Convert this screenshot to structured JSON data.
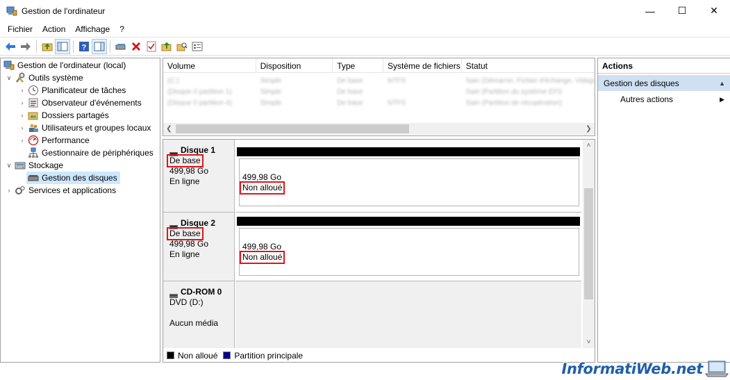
{
  "window": {
    "title": "Gestion de l'ordinateur"
  },
  "menu": [
    "Fichier",
    "Action",
    "Affichage",
    "?"
  ],
  "tree": [
    {
      "label": "Gestion de l'ordinateur (local)",
      "icon": "computer-management-icon"
    },
    {
      "label": "Outils système",
      "icon": "system-tools-icon"
    },
    {
      "label": "Planificateur de tâches",
      "icon": "task-scheduler-icon"
    },
    {
      "label": "Observateur d'événements",
      "icon": "event-viewer-icon"
    },
    {
      "label": "Dossiers partagés",
      "icon": "shared-folders-icon"
    },
    {
      "label": "Utilisateurs et groupes locaux",
      "icon": "users-groups-icon"
    },
    {
      "label": "Performance",
      "icon": "performance-icon"
    },
    {
      "label": "Gestionnaire de périphériques",
      "icon": "device-manager-icon"
    },
    {
      "label": "Stockage",
      "icon": "storage-icon"
    },
    {
      "label": "Gestion des disques",
      "icon": "disk-management-icon"
    },
    {
      "label": "Services et applications",
      "icon": "services-icon"
    }
  ],
  "volumes": {
    "columns": [
      "Volume",
      "Disposition",
      "Type",
      "Système de fichiers",
      "Statut"
    ],
    "rows": [
      [
        "(C:)",
        "Simple",
        "De base",
        "NTFS",
        "Sain (Démarrer, Fichier d'échange, Vidage sur incident, Partition principale)"
      ],
      [
        "(Disque 0 partition 1)",
        "Simple",
        "De base",
        "",
        "Sain (Partition du système EFI)"
      ],
      [
        "(Disque 0 partition 4)",
        "Simple",
        "De base",
        "NTFS",
        "Sain (Partition de récupération)"
      ]
    ]
  },
  "disks": [
    {
      "name": "Disque 1",
      "type": "De base",
      "size": "499,98 Go",
      "state": "En ligne",
      "part_size": "499,98 Go",
      "part_status": "Non alloué"
    },
    {
      "name": "Disque 2",
      "type": "De base",
      "size": "499,98 Go",
      "state": "En ligne",
      "part_size": "499,98 Go",
      "part_status": "Non alloué"
    }
  ],
  "cdrom": {
    "name": "CD-ROM 0",
    "drive": "DVD (D:)",
    "media": "Aucun média"
  },
  "legend": [
    {
      "label": "Non alloué",
      "color": "#000000"
    },
    {
      "label": "Partition principale",
      "color": "#00008b"
    }
  ],
  "actions": {
    "header": "Actions",
    "section": "Gestion des disques",
    "item": "Autres actions"
  },
  "watermark": "InformatiWeb.net",
  "colors": {
    "highlight_box": "#e0151b",
    "selection": "#cce8ff",
    "actions_section": "#cfe0f2"
  }
}
